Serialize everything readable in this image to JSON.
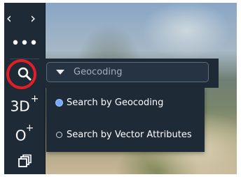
{
  "toolbar": {
    "nav_label": "‹ ›",
    "more_label": "•••",
    "threed_main": "3D",
    "threed_sup": "+",
    "circle_main": "O",
    "circle_sup": "+"
  },
  "search": {
    "select_value": "Geocoding",
    "options": [
      {
        "label": "Search by Geocoding",
        "selected": true
      },
      {
        "label": "Search by Vector Attributes",
        "selected": false
      }
    ]
  },
  "colors": {
    "toolbar_bg": "#1f2a37",
    "highlight": "#e21f26",
    "radio_selected": "#7aa8ff"
  },
  "icons": {
    "nav": "chevron-left-right-icon",
    "more": "more-dots-icon",
    "search": "search-icon",
    "threed": "3d-plus-icon",
    "circle": "circle-plus-icon",
    "stack": "stack-windows-icon",
    "dropdown": "caret-down-icon"
  }
}
